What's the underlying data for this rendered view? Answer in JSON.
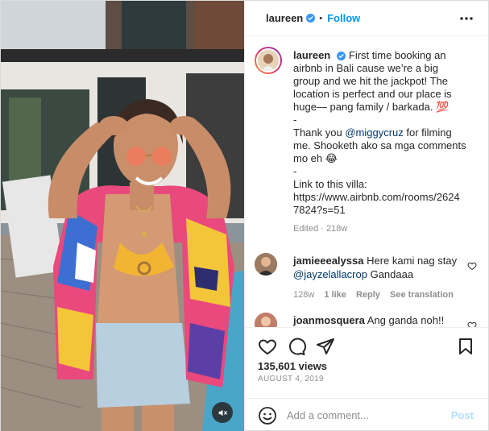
{
  "post": {
    "username": "laureen",
    "follow_label": "Follow",
    "separator": "•",
    "caption_lines": [
      "First time booking an",
      "airbnb in Bali cause we’re a big",
      "group and we hit the jackpot! The",
      "location is perfect and our place is",
      "huge— pang family / barkada. 💯",
      "-",
      "Thank you",
      "@miggycruz",
      "for filming",
      "me. Shooketh ako sa mga comments",
      "mo eh 😂",
      "-",
      "Link to this villa:",
      "https://www.airbnb.com/rooms/2624",
      "7824?s=51"
    ],
    "caption_meta": "Edited · 218w"
  },
  "comments": [
    {
      "username": "jamieeealyssa",
      "text": "Here kami nag stay",
      "mention": "@jayzelallacrop",
      "text_after": "Gandaaa",
      "time": "128w",
      "likes": "1 like",
      "reply_label": "Reply",
      "translate_label": "See translation"
    },
    {
      "username": "joanmosquera",
      "text": "Ang ganda noh!!"
    }
  ],
  "stats": {
    "views": "135,601 views",
    "date": "August 4, 2019"
  },
  "composer": {
    "placeholder": "Add a comment...",
    "post_label": "Post"
  },
  "icons": {
    "verified": "verified-badge-icon",
    "more": "more-options-icon",
    "like": "heart-icon",
    "comment": "comment-icon",
    "share": "share-icon",
    "save": "bookmark-icon",
    "emoji": "emoji-icon",
    "mute": "speaker-muted-icon"
  },
  "colors": {
    "accent": "#0095f6",
    "verified": "#3897f0",
    "mention": "#00376b",
    "muted_text": "#8e8e8e",
    "post_disabled": "#b2dffc"
  }
}
